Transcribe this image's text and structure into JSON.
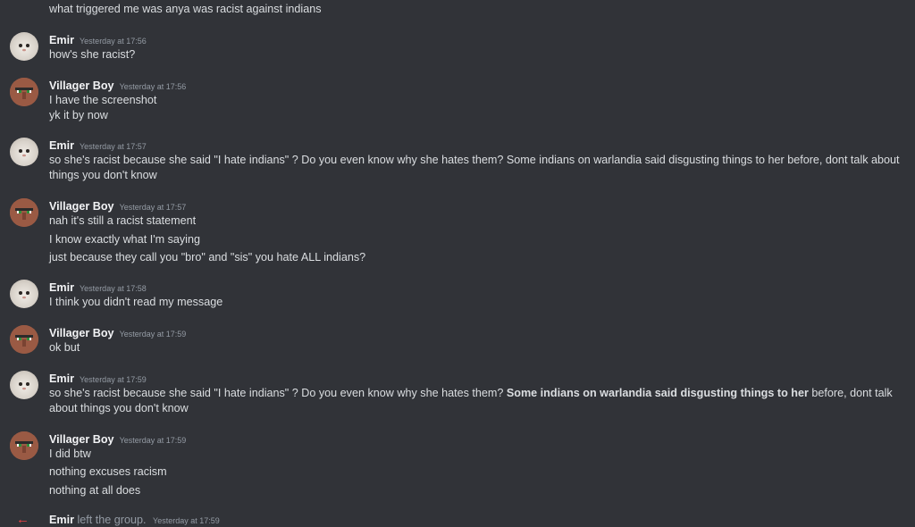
{
  "messages": {
    "top": "what triggered me was anya was racist against indians",
    "m1": {
      "author": "Emir",
      "timestamp": "Yesterday at 17:56",
      "lines": [
        "how's she racist?"
      ]
    },
    "m2": {
      "author": "Villager Boy",
      "timestamp": "Yesterday at 17:56",
      "lines": [
        "I have the screenshot",
        "yk it by now"
      ]
    },
    "m3": {
      "author": "Emir",
      "timestamp": "Yesterday at 17:57",
      "lines": [
        "so she's racist because she said \"I hate indians\" ? Do you even know why she hates them? Some indians on warlandia said disgusting things to her before, dont talk about things you don't know"
      ]
    },
    "m4": {
      "author": "Villager Boy",
      "timestamp": "Yesterday at 17:57",
      "lines": [
        "nah it's still a racist statement",
        "I know exactly what I'm saying",
        "just because they call you \"bro\" and \"sis\" you hate ALL indians?"
      ]
    },
    "m5": {
      "author": "Emir",
      "timestamp": "Yesterday at 17:58",
      "lines": [
        "I think you didn't read my message"
      ]
    },
    "m6": {
      "author": "Villager Boy",
      "timestamp": "Yesterday at 17:59",
      "lines": [
        "ok but"
      ]
    },
    "m7": {
      "author": "Emir",
      "timestamp": "Yesterday at 17:59",
      "pre": "so she's racist because she said \"I hate indians\" ? Do you even know why she hates them? ",
      "bold": "Some indians on warlandia said disgusting things to her",
      "post": " before, dont talk about things you don't know"
    },
    "m8": {
      "author": "Villager Boy",
      "timestamp": "Yesterday at 17:59",
      "lines": [
        "I did btw",
        "nothing excuses racism",
        "nothing at all does"
      ]
    }
  },
  "system": {
    "who": "Emir",
    "action": "left the group.",
    "timestamp": "Yesterday at 17:59"
  },
  "colors": {
    "background": "#313338",
    "text": "#dbdee1",
    "muted": "#949ba4",
    "leave": "#ed4245"
  },
  "icons": {
    "leave": "arrow-left-icon"
  }
}
